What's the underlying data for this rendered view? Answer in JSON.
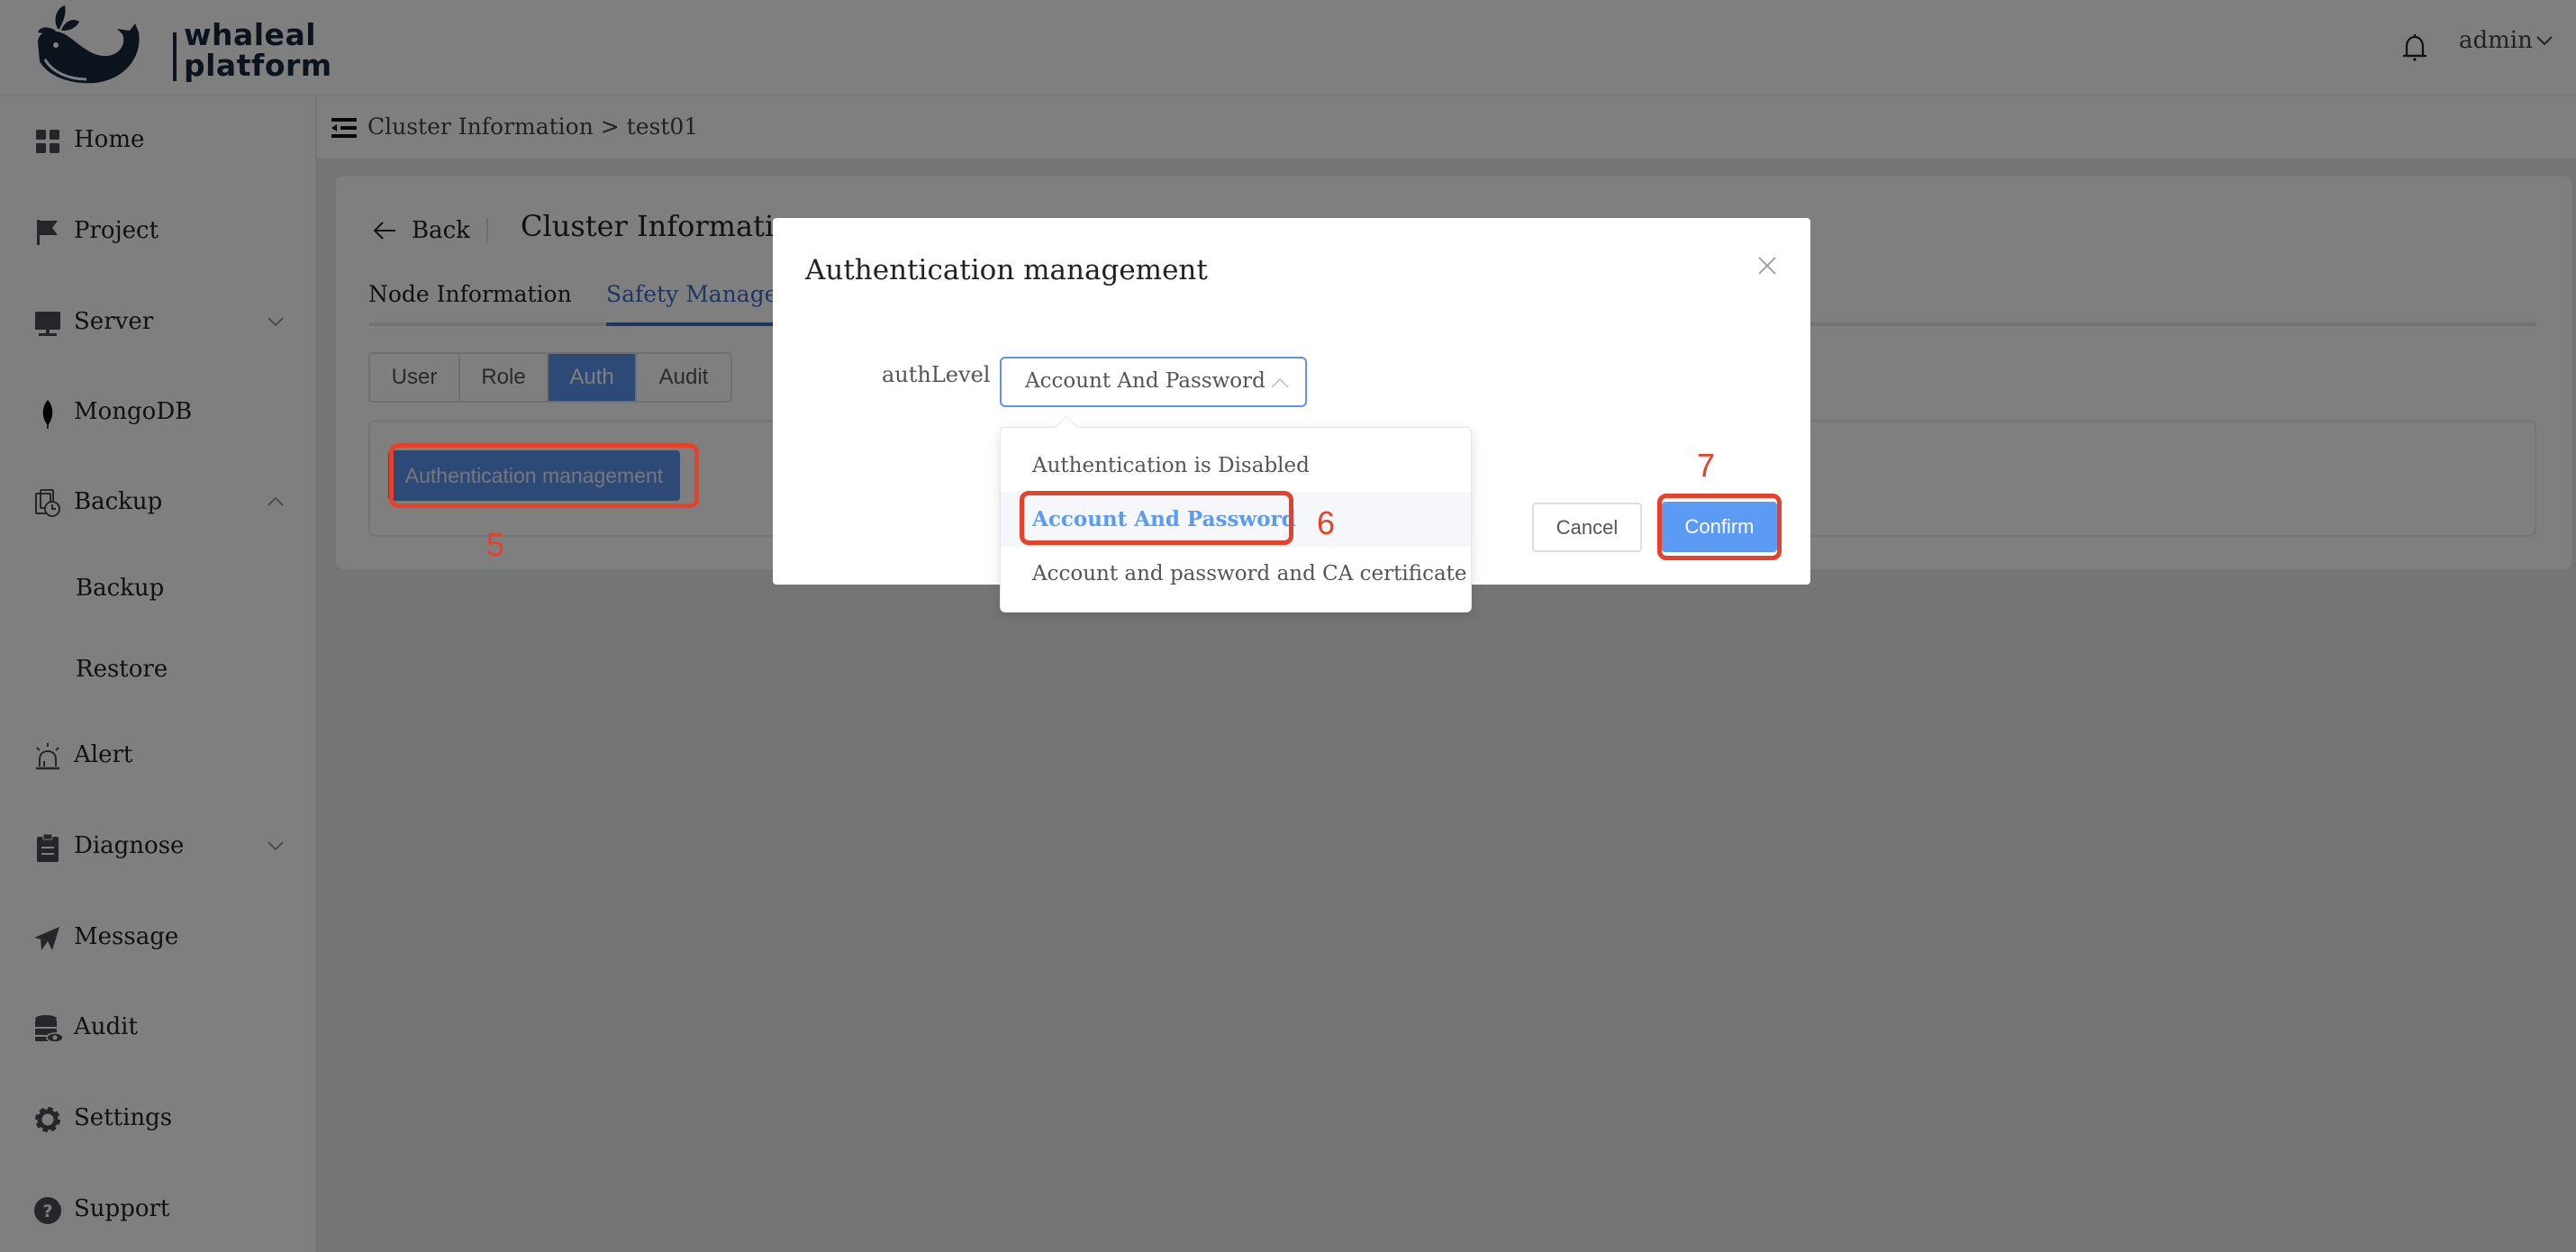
{
  "header": {
    "logo_line1": "whaleal",
    "logo_line2": "platform",
    "bell_icon": "bell-icon",
    "user_name": "admin",
    "user_chevron": "chevron-down-icon"
  },
  "sidebar": {
    "items": [
      {
        "label": "Home",
        "icon": "grid-icon"
      },
      {
        "label": "Project",
        "icon": "flag-icon"
      },
      {
        "label": "Server",
        "icon": "monitor-icon",
        "chevron": "down"
      },
      {
        "label": "MongoDB",
        "icon": "leaf-icon"
      },
      {
        "label": "Backup",
        "icon": "backup-clock-icon",
        "chevron": "up",
        "expanded": true
      },
      {
        "label": "Backup",
        "sub": true
      },
      {
        "label": "Restore",
        "sub": true
      },
      {
        "label": "Alert",
        "icon": "alarm-icon"
      },
      {
        "label": "Diagnose",
        "icon": "clipboard-icon",
        "chevron": "down"
      },
      {
        "label": "Message",
        "icon": "send-icon"
      },
      {
        "label": "Audit",
        "icon": "database-eye-icon"
      },
      {
        "label": "Settings",
        "icon": "gear-icon"
      },
      {
        "label": "Support",
        "icon": "help-icon"
      }
    ]
  },
  "breadcrumb": {
    "icon": "menu-fold-icon",
    "text": "Cluster Information > test01"
  },
  "card": {
    "back_label": "Back",
    "title": "Cluster Information",
    "tabs": [
      {
        "label": "Node Information",
        "active": false
      },
      {
        "label": "Safety Management",
        "active": true
      }
    ],
    "segments": [
      {
        "label": "User",
        "active": false
      },
      {
        "label": "Role",
        "active": false
      },
      {
        "label": "Auth",
        "active": true
      },
      {
        "label": "Audit",
        "active": false
      }
    ],
    "auth_button_label": "Authentication management"
  },
  "modal": {
    "title": "Authentication management",
    "field_label": "authLevel",
    "select_value": "Account And Password",
    "options": [
      {
        "label": "Authentication is Disabled",
        "selected": false
      },
      {
        "label": "Account And Password",
        "selected": true
      },
      {
        "label": "Account and password and CA certificate",
        "selected": false
      }
    ],
    "cancel_label": "Cancel",
    "confirm_label": "Confirm"
  },
  "annotations": [
    {
      "number": "5",
      "target": "auth-management-button"
    },
    {
      "number": "6",
      "target": "option-account-and-password"
    },
    {
      "number": "7",
      "target": "confirm-button"
    }
  ],
  "colors": {
    "primary": "#5b95ee",
    "confirm": "#5b9bf5",
    "annotation": "#e8412a",
    "logo": "#16263a"
  }
}
